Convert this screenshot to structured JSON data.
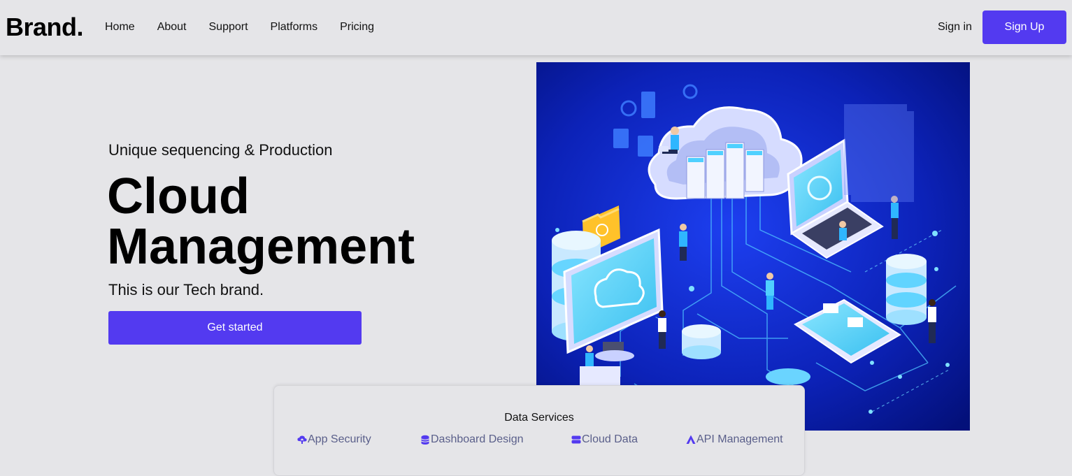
{
  "nav": {
    "brand": "Brand.",
    "links": [
      "Home",
      "About",
      "Support",
      "Platforms",
      "Pricing"
    ],
    "signin": "Sign in",
    "signup": "Sign Up"
  },
  "hero": {
    "subtitle": "Unique sequencing & Production",
    "title_line1": "Cloud",
    "title_line2": "Management",
    "description": "This is our Tech brand.",
    "cta": "Get started",
    "illustration_icon": "cloud-network-illustration"
  },
  "services": {
    "title": "Data Services",
    "items": [
      {
        "label": "App Security",
        "icon": "cloud-upload-icon"
      },
      {
        "label": "Dashboard Design",
        "icon": "database-icon"
      },
      {
        "label": "Cloud Data",
        "icon": "server-icon"
      },
      {
        "label": "API Management",
        "icon": "triangle-logo-icon"
      }
    ]
  },
  "colors": {
    "accent": "#533af0",
    "background": "#e5e5e8",
    "illustration_bg": "#0a1fb0",
    "service_text": "#5a5f8a"
  }
}
